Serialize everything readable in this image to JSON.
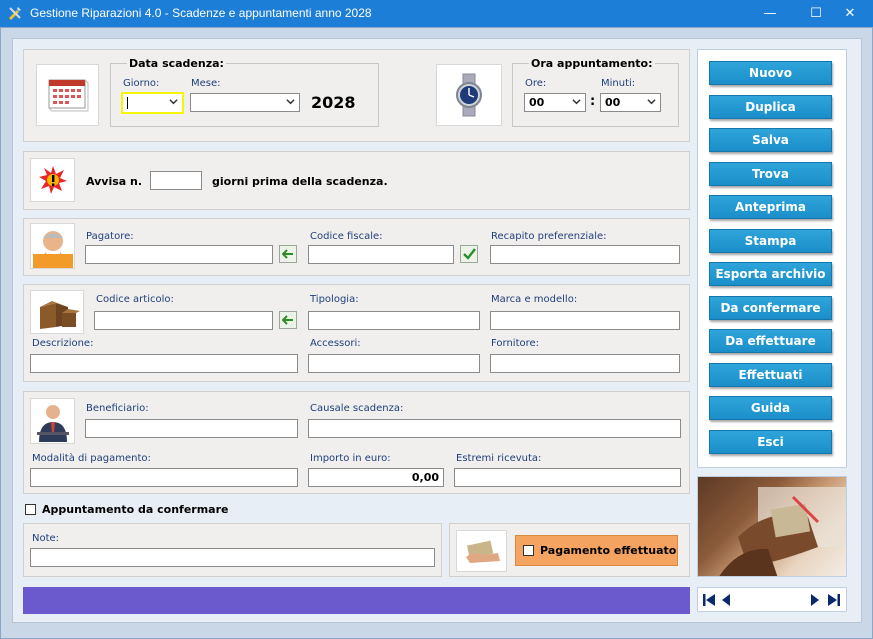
{
  "window": {
    "title": "Gestione Riparazioni 4.0 - Scadenze e appuntamenti anno 2028",
    "minimize_glyph": "—",
    "maximize_glyph": "☐",
    "close_glyph": "✕"
  },
  "due_date": {
    "group_label": "Data scadenza:",
    "day_label": "Giorno:",
    "day_value": "",
    "month_label": "Mese:",
    "month_value": "",
    "year": "2028"
  },
  "appointment_time": {
    "group_label": "Ora appuntamento:",
    "hours_label": "Ore:",
    "hours_value": "00",
    "minutes_label": "Minuti:",
    "minutes_value": "00",
    "separator": ":"
  },
  "notice": {
    "prefix": "Avvisa n.",
    "days_value": "",
    "suffix": "giorni prima della scadenza."
  },
  "payer": {
    "payer_label": "Pagatore:",
    "tax_code_label": "Codice fiscale:",
    "contact_label": "Recapito preferenziale:"
  },
  "article": {
    "code_label": "Codice articolo:",
    "type_label": "Tipologia:",
    "brand_label": "Marca e modello:",
    "description_label": "Descrizione:",
    "accessories_label": "Accessori:",
    "supplier_label": "Fornitore:"
  },
  "beneficiary": {
    "beneficiary_label": "Beneficiario:",
    "reason_label": "Causale scadenza:",
    "payment_method_label": "Modalità di pagamento:",
    "amount_label": "Importo in euro:",
    "amount_value": "0,00",
    "receipt_label": "Estremi ricevuta:"
  },
  "to_confirm_label": "Appuntamento da confermare",
  "notes_label": "Note:",
  "payment_done_label": "Pagamento effettuato",
  "buttons": {
    "new": "Nuovo",
    "duplicate": "Duplica",
    "save": "Salva",
    "find": "Trova",
    "preview": "Anteprima",
    "print": "Stampa",
    "export": "Esporta archivio",
    "to_confirm": "Da confermare",
    "to_do": "Da effettuare",
    "done": "Effettuati",
    "guide": "Guida",
    "exit": "Esci"
  },
  "colors": {
    "titlebar": "#1c7ed6",
    "command_button": "#1b8ec9",
    "status_bar": "#6a5acd",
    "payment_panel": "#f4a460",
    "focus_border": "#f5f50a"
  }
}
